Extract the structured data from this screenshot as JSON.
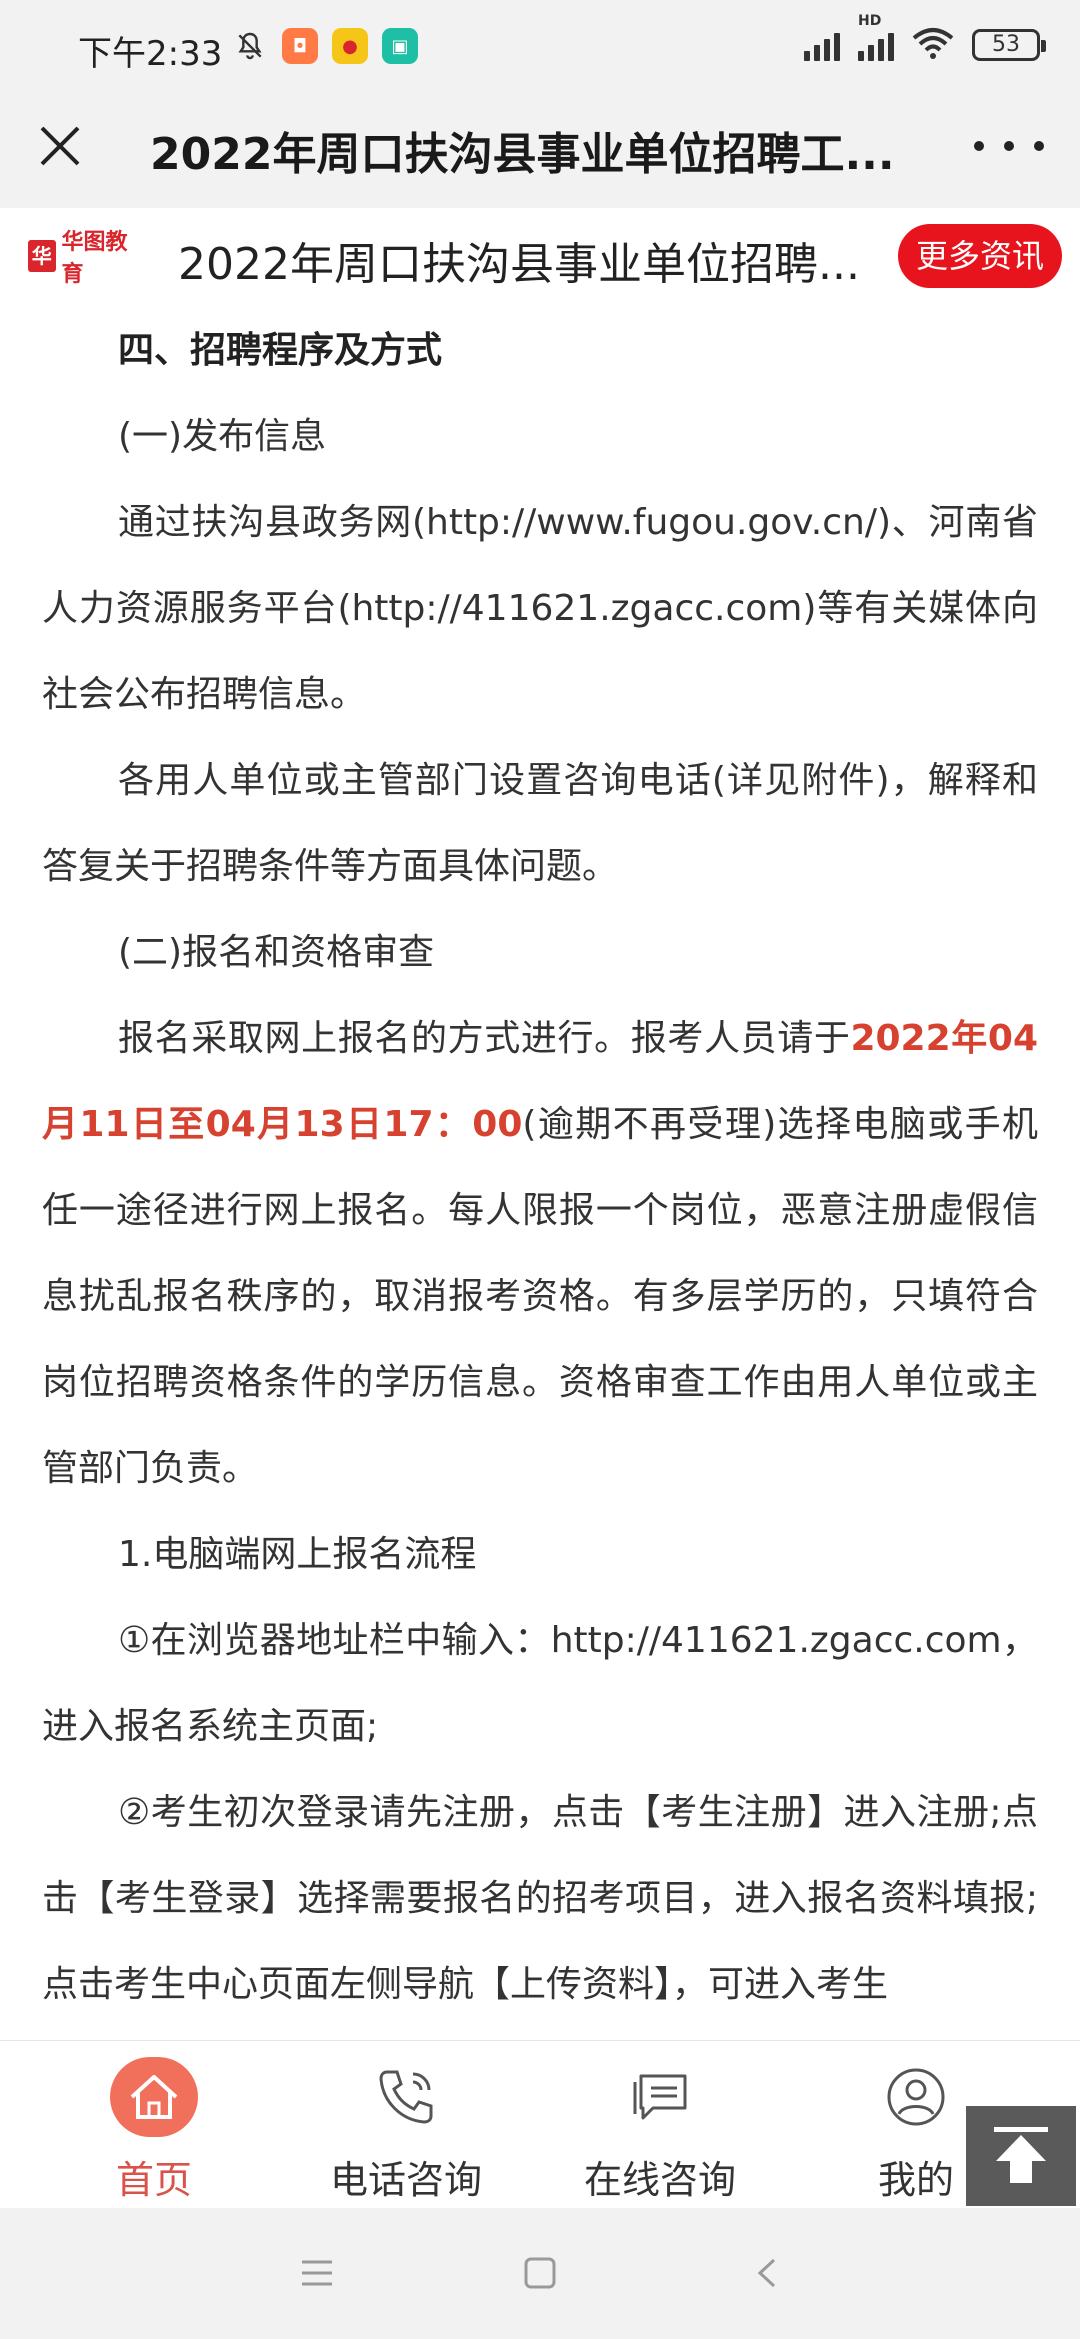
{
  "status": {
    "time": "下午2:33",
    "battery": "53",
    "network": "HD"
  },
  "title_bar": {
    "title": "2022年周口扶沟县事业单位招聘工..."
  },
  "article_header": {
    "logo_text": "华图教育",
    "title": "2022年周口扶沟县事业单位招聘...",
    "more_button": "更多资讯"
  },
  "content": {
    "p1": "四、招聘程序及方式",
    "p2": "(一)发布信息",
    "p3": "通过扶沟县政务网(http://www.fugou.gov.cn/)、河南省人力资源服务平台(http://411621.zgacc.com)等有关媒体向社会公布招聘信息。",
    "p4": "各用人单位或主管部门设置咨询电话(详见附件)，解释和答复关于招聘条件等方面具体问题。",
    "p5": "(二)报名和资格审查",
    "p6_a": "报名采取网上报名的方式进行。报考人员请于",
    "p6_b": "2022年04月11日至04月13日17：00",
    "p6_c": "(逾期不再受理)选择电脑或手机任一途径进行网上报名。每人限报一个岗位，恶意注册虚假信息扰乱报名秩序的，取消报考资格。有多层学历的，只填符合岗位招聘资格条件的学历信息。资格审查工作由用人单位或主管部门负责。",
    "p7": "1.电脑端网上报名流程",
    "p8": "①在浏览器地址栏中输入：http://411621.zgacc.com，进入报名系统主页面;",
    "p9": "②考生初次登录请先注册，点击【考生注册】进入注册;点击【考生登录】选择需要报名的招考项目，进入报名资料填报;点击考生中心页面左侧导航【上传资料】，可进入考生"
  },
  "bottom_nav": {
    "home": "首页",
    "phone": "电话咨询",
    "online": "在线咨询",
    "mine": "我的"
  },
  "colors": {
    "accent": "#e8141d",
    "highlight": "#d6422f",
    "home_active": "#f0705c"
  },
  "icons": {
    "close": "close-icon",
    "more": "more-icon",
    "home": "home-icon",
    "phone": "phone-icon",
    "chat": "chat-icon",
    "user": "user-icon",
    "back_to_top": "arrow-up-icon"
  }
}
